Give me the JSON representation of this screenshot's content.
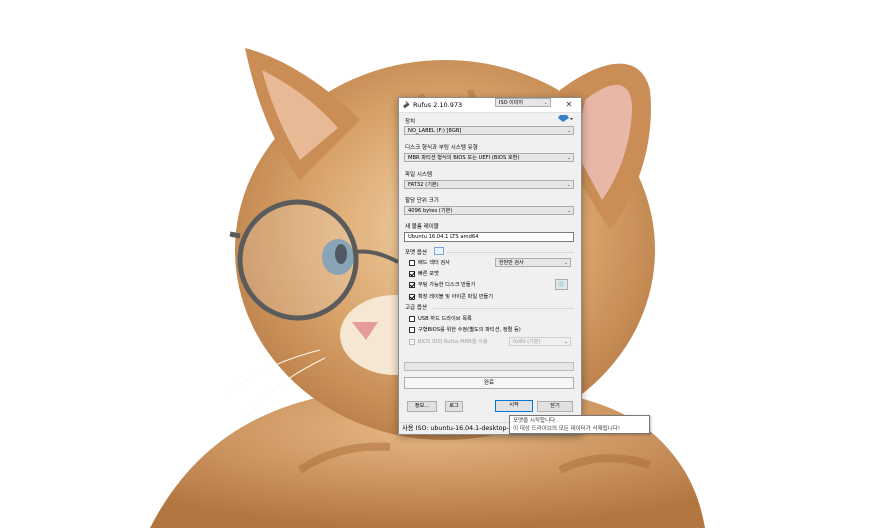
{
  "window": {
    "title": "Rufus 2.10.973",
    "minimize_label": "—",
    "maximize_label": "☐",
    "close_label": "✕"
  },
  "device": {
    "label": "장치",
    "value": "NO_LABEL (F:) [8GB]"
  },
  "partition": {
    "label": "디스크 형식과 부팅 시스템 유형",
    "value": "MBR 파티션 형식의 BIOS 또는 UEFI (BIOS 호환)"
  },
  "filesystem": {
    "label": "파일 시스템",
    "value": "FAT32 (기본)"
  },
  "cluster": {
    "label": "할당 단위 크기",
    "value": "4096 bytes (기본)"
  },
  "volume": {
    "label": "새 볼륨 레이블",
    "value": "Ubuntu 16.04.1 LTS amd64"
  },
  "format_options": {
    "label": "포맷 옵션",
    "bad_blocks": {
      "label": "배드 섹터 검사",
      "checked": false
    },
    "bad_blocks_passes": "한번만 검사",
    "quick_format": {
      "label": "빠른 포맷",
      "checked": true
    },
    "bootable": {
      "label": "부팅 가능한 디스크 만들기",
      "checked": true
    },
    "boot_type": "ISO 이미지",
    "extended_label": {
      "label": "확장 레이블 및 아이콘 파일 만들기",
      "checked": true
    }
  },
  "advanced": {
    "label": "고급 옵션",
    "usb_hdd": {
      "label": "USB 하드 드라이브 목록",
      "checked": false
    },
    "old_bios": {
      "label": "구형BIOS를 위한 수정(별도의 파티션, 정렬 등)",
      "checked": false
    },
    "rufus_mbr": {
      "label": "BIOS ID와 Rufus MBR을 사용",
      "checked": false
    },
    "bios_id": "0x80 (기본)"
  },
  "progress": {
    "fraction": 0.0
  },
  "status_text": "완료",
  "buttons": {
    "about": "정보...",
    "log": "로그",
    "start": "시작",
    "close": "닫기"
  },
  "statusbar": {
    "text": "사용 ISO: ubuntu-16.04.1-desktop-am"
  },
  "tooltip": {
    "line1": "포맷을 시작합니다.",
    "line2": "이 대상 드라이브의 모든 데이터가 삭제됩니다!"
  },
  "colors": {
    "accent": "#0078d7",
    "window_bg": "#f0f0f0",
    "progress_green": "#06b025"
  }
}
